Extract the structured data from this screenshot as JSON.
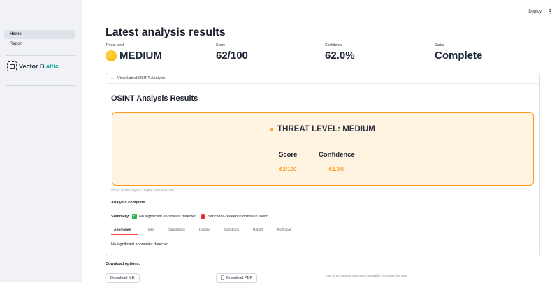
{
  "sidebar": {
    "items": [
      {
        "label": "Home",
        "active": true
      },
      {
        "label": "Report",
        "active": false
      }
    ],
    "logo": {
      "text": "Vector B",
      "accent": ".altic"
    }
  },
  "header": {
    "deploy_label": "Deploy",
    "menu_glyph": "⋮"
  },
  "page": {
    "title": "Latest analysis results"
  },
  "metrics": [
    {
      "label": "Threat level",
      "value": "MEDIUM",
      "icon": "yellow-circle-icon"
    },
    {
      "label": "Score",
      "value": "62/100"
    },
    {
      "label": "Confidence",
      "value": "62.0%"
    },
    {
      "label": "Status",
      "value": "Complete"
    }
  ],
  "expander": {
    "label": "View Latest OSINT Analysis",
    "expanded": true,
    "title": "OSINT Analysis Results",
    "threat_banner": {
      "text": "THREAT LEVEL: MEDIUM",
      "score_label": "Score",
      "score_value": "62/100",
      "confidence_label": "Confidence",
      "confidence_value": "62.0%",
      "accent_color": "#ff9a1f",
      "background_color": "#fff3e1"
    },
    "caption": "Score: 0–100 (higher = higher assessed risk)",
    "analysis_status": "Analysis complete",
    "summary": {
      "prefix": "Summary:",
      "part1": "No significant anomalies detected |",
      "part2": "Sanctions-related information found"
    },
    "tabs": [
      {
        "label": "Anomalies",
        "active": true
      },
      {
        "label": "Intel",
        "active": false
      },
      {
        "label": "Capabilities",
        "active": false
      },
      {
        "label": "History",
        "active": false
      },
      {
        "label": "Sanctions",
        "active": false
      },
      {
        "label": "Report",
        "active": false
      },
      {
        "label": "Technical",
        "active": false
      }
    ],
    "tab_content": "No significant anomalies detected"
  },
  "downloads": {
    "label": "Download options:",
    "md_label": "Download MD",
    "pdf_label": "Download PDF",
    "note": "Full threat assessment report available in multiple formats"
  }
}
